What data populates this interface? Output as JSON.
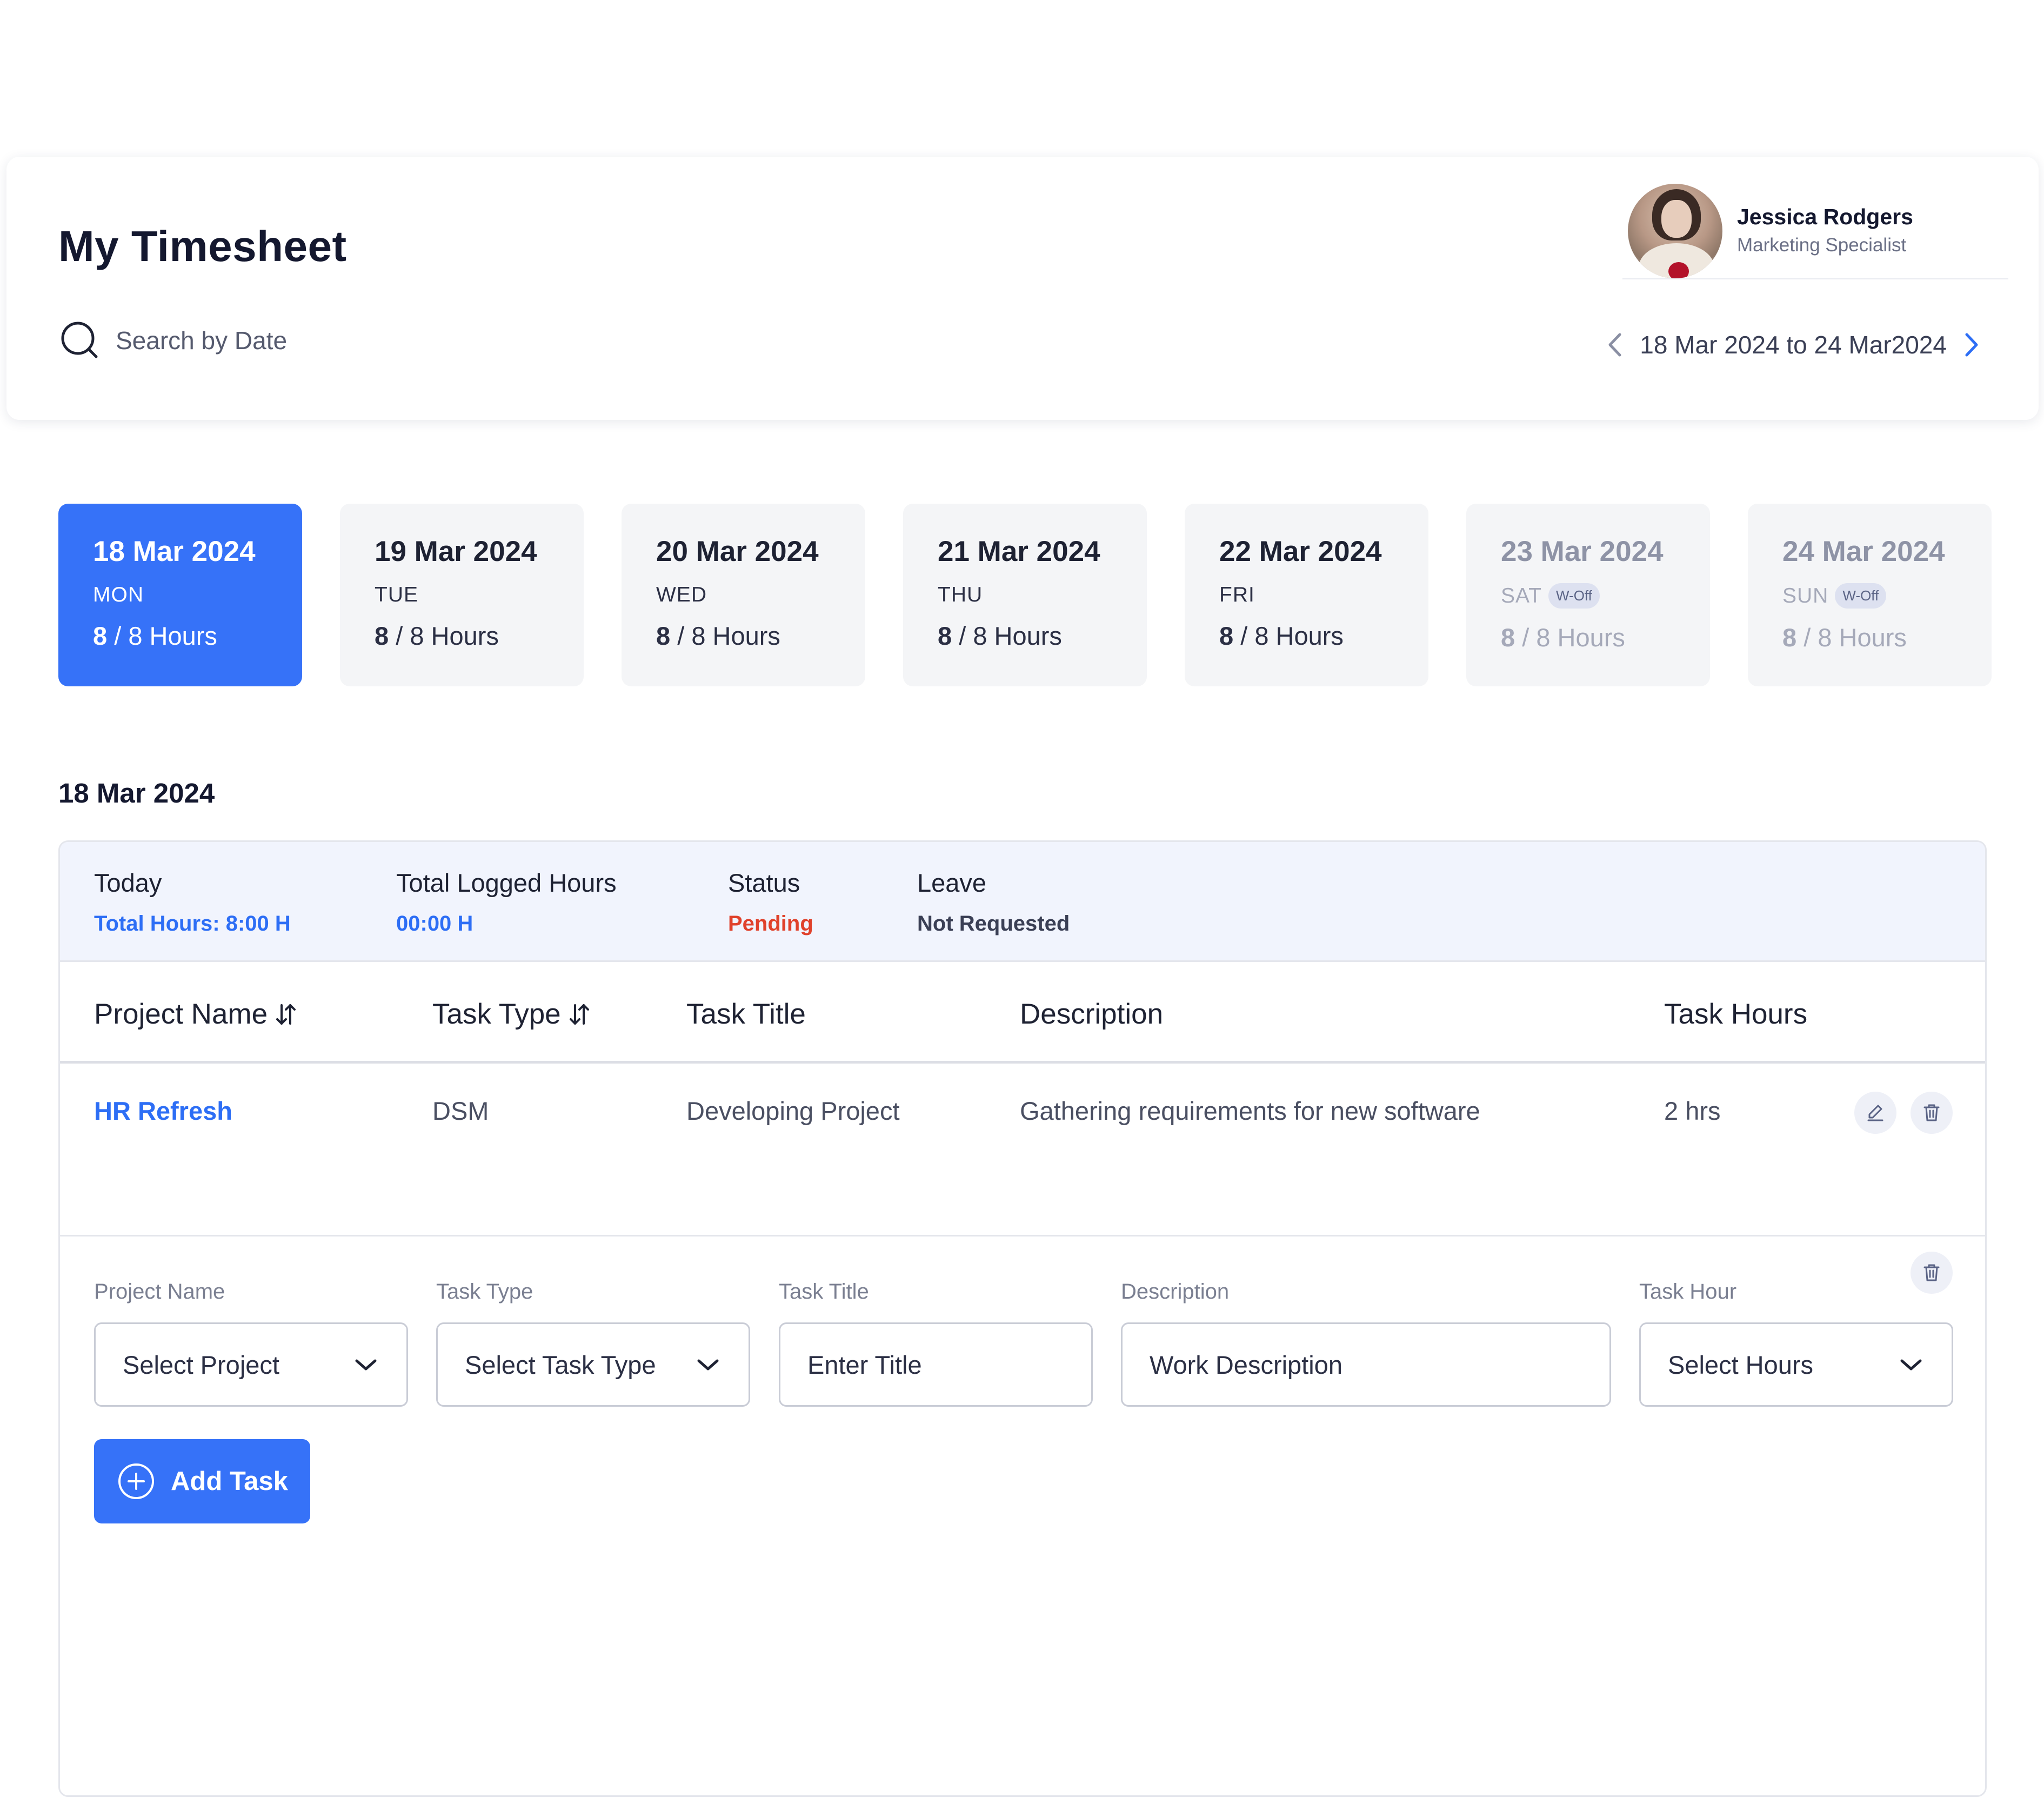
{
  "header": {
    "title": "My Timesheet",
    "search_placeholder": "Search by Date",
    "user": {
      "name": "Jessica Rodgers",
      "role": "Marketing Specialist"
    },
    "date_range": "18 Mar 2024 to 24 Mar2024"
  },
  "days": [
    {
      "date": "18 Mar 2024",
      "weekday": "MON",
      "logged": "8",
      "total": "/ 8 Hours",
      "active": true,
      "off": false
    },
    {
      "date": "19 Mar 2024",
      "weekday": "TUE",
      "logged": "8",
      "total": "/ 8 Hours",
      "active": false,
      "off": false
    },
    {
      "date": "20 Mar 2024",
      "weekday": "WED",
      "logged": "8",
      "total": "/ 8 Hours",
      "active": false,
      "off": false
    },
    {
      "date": "21 Mar 2024",
      "weekday": "THU",
      "logged": "8",
      "total": "/ 8 Hours",
      "active": false,
      "off": false
    },
    {
      "date": "22 Mar 2024",
      "weekday": "FRI",
      "logged": "8",
      "total": "/ 8 Hours",
      "active": false,
      "off": false
    },
    {
      "date": "23 Mar 2024",
      "weekday": "SAT",
      "badge": "W-Off",
      "logged": "8",
      "total": "/ 8 Hours",
      "active": false,
      "off": true
    },
    {
      "date": "24 Mar 2024",
      "weekday": "SUN",
      "badge": "W-Off",
      "logged": "8",
      "total": "/ 8 Hours",
      "active": false,
      "off": true
    }
  ],
  "selected_date": "18 Mar 2024",
  "summary": {
    "today": {
      "label": "Today",
      "value": "Total Hours: 8:00 H"
    },
    "logged": {
      "label": "Total Logged Hours",
      "value": "00:00 H"
    },
    "status": {
      "label": "Status",
      "value": "Pending"
    },
    "leave": {
      "label": "Leave",
      "value": "Not Requested"
    }
  },
  "table": {
    "headers": [
      "Project Name",
      "Task Type",
      "Task Title",
      "Description",
      "Task Hours"
    ],
    "rows": [
      {
        "project": "HR Refresh",
        "type": "DSM",
        "title": "Developing Project",
        "description": "Gathering requirements for new software",
        "hours": "2 hrs"
      }
    ]
  },
  "form": {
    "labels": {
      "project": "Project Name",
      "type": "Task Type",
      "title": "Task Title",
      "description": "Description",
      "hours": "Task Hour"
    },
    "placeholders": {
      "project": "Select Project",
      "type": "Select Task Type",
      "title": "Enter Title",
      "description": "Work Description",
      "hours": "Select Hours"
    },
    "add_label": "Add Task"
  },
  "colors": {
    "primary": "#3672f8",
    "link": "#2d6ef5",
    "pending": "#e0412b"
  },
  "icons": [
    "search-icon",
    "chevron-left-icon",
    "chevron-right-icon",
    "sort-icon",
    "edit-icon",
    "trash-icon",
    "chevron-down-icon",
    "plus-circle-icon"
  ]
}
